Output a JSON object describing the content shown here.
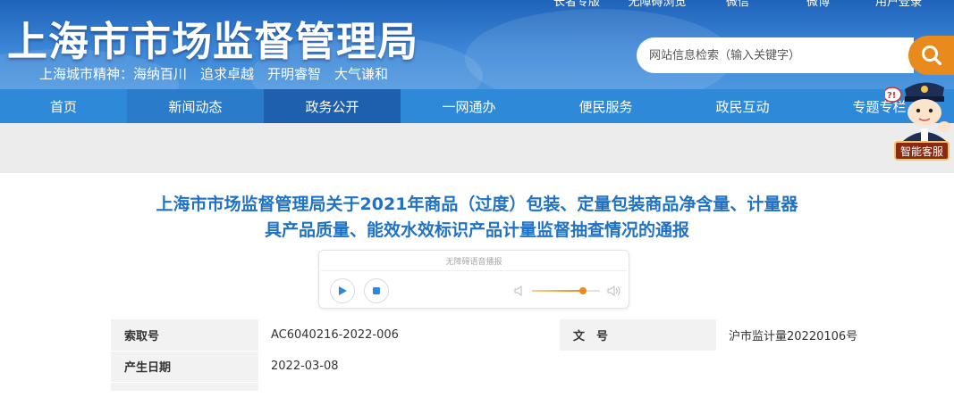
{
  "top_links": [
    "长者专版",
    "无障碍浏览",
    "微信",
    "微博",
    "用户登录"
  ],
  "header": {
    "site_title": "上海市市场监督管理局",
    "slogan": "上海城市精神：海纳百川　追求卓越　开明睿智　大气谦和",
    "search_placeholder": "网站信息检索（输入关键字）",
    "search_icon": "search-icon"
  },
  "nav": {
    "items": [
      "首页",
      "新闻动态",
      "政务公开",
      "一网通办",
      "便民服务",
      "政民互动",
      "专题专栏"
    ],
    "active_index": 2
  },
  "assistant": {
    "label": "智能客服",
    "bubble": "?!"
  },
  "article": {
    "title_line1": "上海市市场监督管理局关于2021年商品（过度）包装、定量包装商品净含量、计量器",
    "title_line2": "具产品质量、能效水效标识产品计量监督抽查情况的通报"
  },
  "player": {
    "caption": "无障碍语音播报",
    "play_icon": "play-icon",
    "stop_icon": "stop-icon",
    "volume_level": 0.75
  },
  "meta": {
    "index_label": "索取号",
    "index_value": "AC6040216-2022-006",
    "doc_label": "文　号",
    "doc_value": "沪市监计量20220106号",
    "date_label": "产生日期",
    "date_value": "2022-03-08"
  },
  "colors": {
    "header_blue": "#2e6fc4",
    "nav_blue": "#2e8ad8",
    "nav_active": "#1e5fae",
    "title_blue": "#1f72c4",
    "search_orange": "#e98a1c"
  }
}
